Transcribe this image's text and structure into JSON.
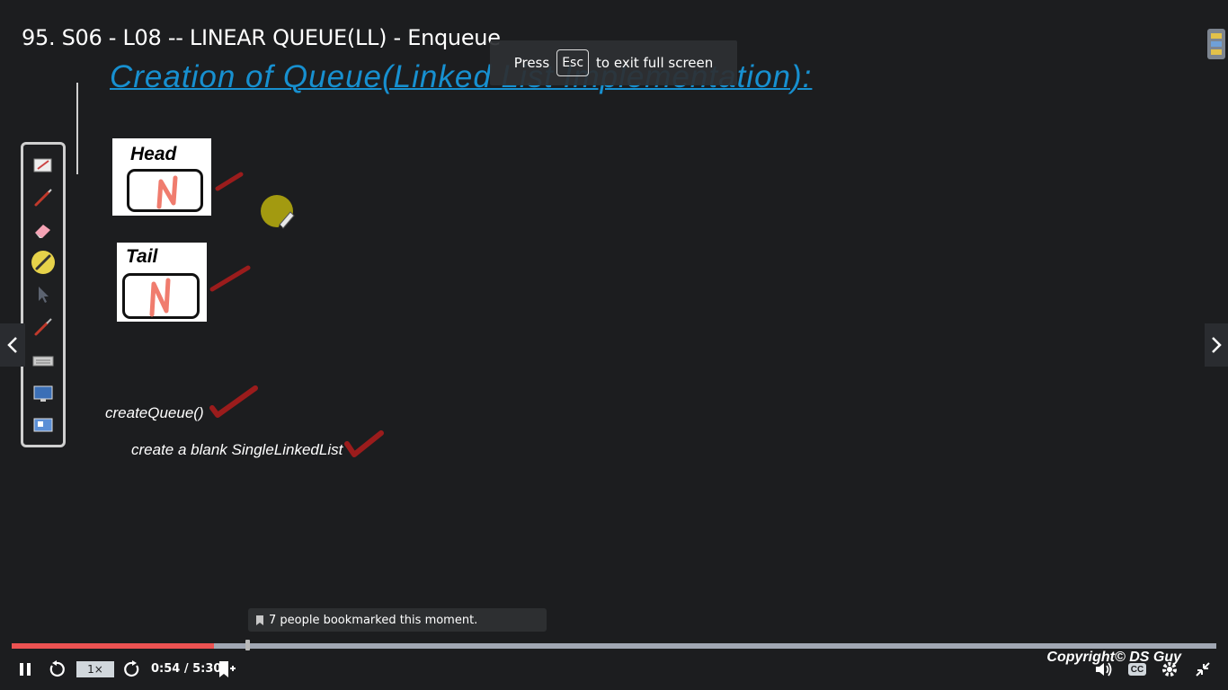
{
  "player": {
    "lecture_title": "95. S06 - L08 -- LINEAR QUEUE(LL) - Enqueue",
    "fullscreen_notice": {
      "before": "Press",
      "key": "Esc",
      "after": "to exit full screen"
    },
    "bookmark_tooltip": "7 people bookmarked this moment.",
    "progress_fraction": 0.168,
    "speed_label": "1×",
    "time_display": "0:54 / 5:30"
  },
  "slide": {
    "heading": "Creation of Queue(Linked List Implementation):",
    "head_box_label": "Head",
    "tail_box_label": "Tail",
    "head_value": "N",
    "tail_value": "N",
    "code_line": "createQueue()",
    "description_line": "create a blank SingleLinkedList",
    "copyright": "Copyright© DS Guy"
  },
  "colors": {
    "accent_blue": "#1790d0",
    "progress_red": "#ec5252",
    "annotation_red": "#9b1c1c",
    "value_pink": "#f07c6e",
    "pointer_yellow": "#a39a10"
  },
  "toolbar_icons": [
    "notepad-icon",
    "pen-icon",
    "eraser-icon",
    "highlighter-icon",
    "pointer-icon",
    "marker-icon",
    "keyboard-icon",
    "screen-icon",
    "presentation-icon"
  ]
}
